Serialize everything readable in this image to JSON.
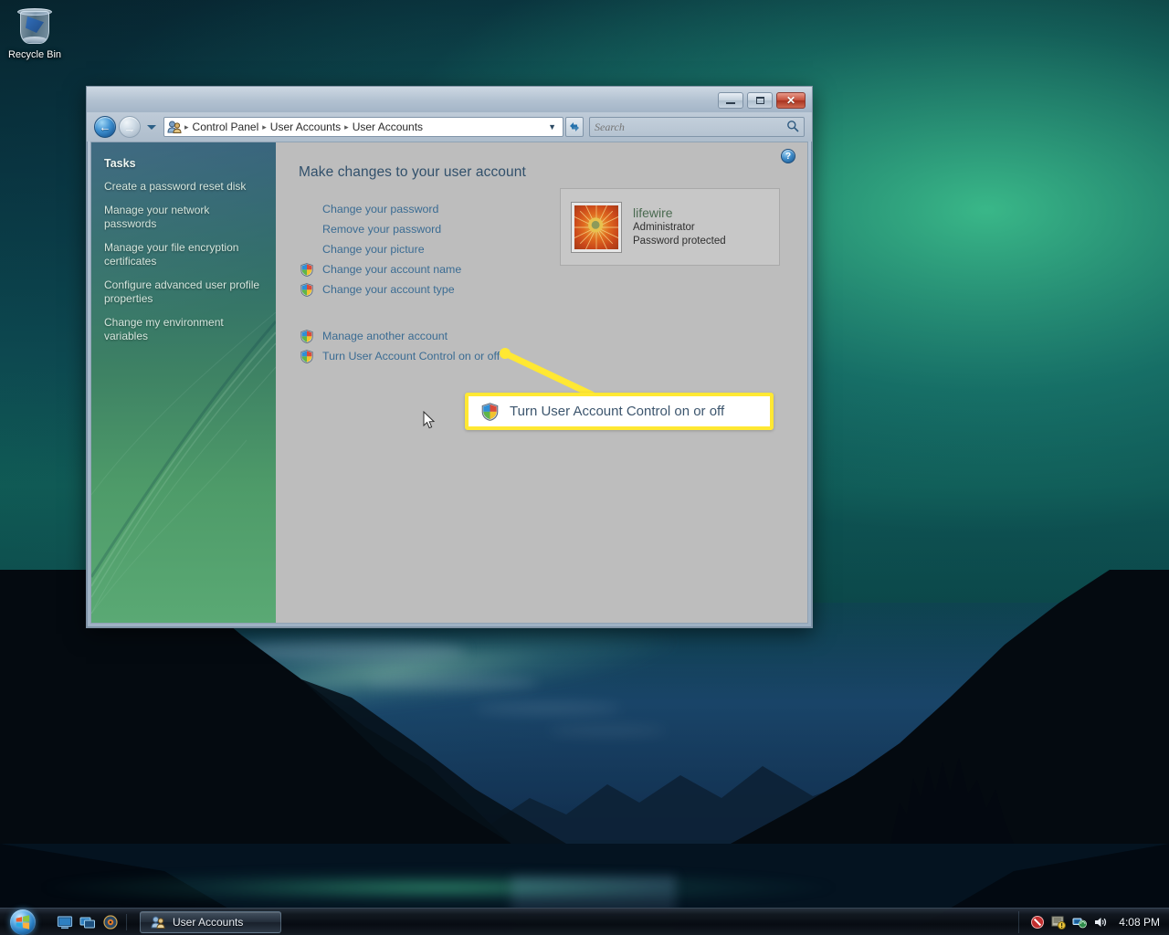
{
  "desktop": {
    "icons": [
      {
        "label": "Recycle Bin",
        "icon": "recycle-bin-icon"
      }
    ]
  },
  "window": {
    "title": "User Accounts",
    "buttons": {
      "minimize": "Minimize",
      "maximize": "Maximize",
      "close": "Close"
    },
    "nav": {
      "back": "Back",
      "forward": "Forward",
      "recent_pages": "Recent Pages",
      "refresh": "Refresh"
    },
    "address": {
      "icon": "user-accounts-icon",
      "crumbs": [
        "Control Panel",
        "User Accounts",
        "User Accounts"
      ],
      "separator": "▸",
      "caret": "▼"
    },
    "search": {
      "placeholder": "Search",
      "value": "",
      "icon": "search-icon"
    },
    "help": {
      "label": "?",
      "icon": "help-icon"
    }
  },
  "sidebar": {
    "title": "Tasks",
    "items": [
      {
        "label": "Create a password reset disk"
      },
      {
        "label": "Manage your network passwords"
      },
      {
        "label": "Manage your file encryption certificates"
      },
      {
        "label": "Configure advanced user profile properties"
      },
      {
        "label": "Change my environment variables"
      }
    ]
  },
  "content": {
    "heading": "Make changes to your user account",
    "links_group_1": [
      {
        "label": "Change your password",
        "shield": false
      },
      {
        "label": "Remove your password",
        "shield": false
      },
      {
        "label": "Change your picture",
        "shield": false
      },
      {
        "label": "Change your account name",
        "shield": true
      },
      {
        "label": "Change your account type",
        "shield": true
      }
    ],
    "links_group_2": [
      {
        "label": "Manage another account",
        "shield": true
      },
      {
        "label": "Turn User Account Control on or off",
        "shield": true
      }
    ],
    "account_card": {
      "name": "lifewire",
      "role": "Administrator",
      "protection": "Password protected",
      "picture": "sunflower-avatar"
    }
  },
  "callout": {
    "text": "Turn User Account Control on or off",
    "shield_icon": "uac-shield-icon",
    "border_color": "#ffe833"
  },
  "taskbar": {
    "start": {
      "label": "Start",
      "icon": "windows-orb-icon"
    },
    "quick_launch": [
      {
        "icon": "show-desktop-icon"
      },
      {
        "icon": "switch-windows-icon"
      },
      {
        "icon": "media-player-icon"
      }
    ],
    "tasks": [
      {
        "label": "User Accounts",
        "icon": "user-accounts-icon",
        "active": true
      }
    ],
    "tray": [
      {
        "icon": "security-alert-icon"
      },
      {
        "icon": "action-center-icon"
      },
      {
        "icon": "network-icon"
      },
      {
        "icon": "volume-icon"
      }
    ],
    "clock": "4:08 PM"
  },
  "colors": {
    "link": "#3b6c93",
    "heading": "#31506b",
    "callout_yellow": "#ffe833",
    "sidebar_top": "#2b5a74",
    "sidebar_bottom": "#5aa974"
  }
}
